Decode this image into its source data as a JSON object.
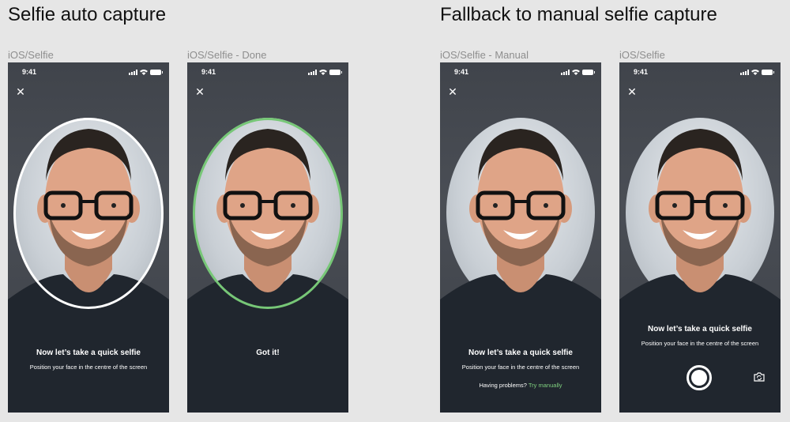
{
  "sections": [
    {
      "title": "Selfie auto capture"
    },
    {
      "title": "Fallback to manual selfie capture"
    }
  ],
  "screens": [
    {
      "label": "iOS/Selfie",
      "time": "9:41",
      "prompt": "Now let’s take a quick selfie",
      "subprompt": "Position your face in the centre of the screen"
    },
    {
      "label": "iOS/Selfie - Done",
      "time": "9:41",
      "prompt": "Got it!"
    },
    {
      "label": "iOS/Selfie - Manual",
      "time": "9:41",
      "prompt": "Now let’s take a quick selfie",
      "subprompt": "Position your face in the centre of the screen",
      "help_text": "Having problems?",
      "help_link": "Try manually"
    },
    {
      "label": "iOS/Selfie",
      "time": "9:41",
      "prompt": "Now let’s take a quick selfie",
      "subprompt": "Position your face in the centre of the screen"
    }
  ],
  "icons": {
    "close": "close-icon",
    "shutter": "shutter-button",
    "switch_camera": "switch-camera-icon"
  },
  "colors": {
    "success_ring": "#77c777",
    "guide_ring": "#ffffff",
    "link": "#7fd07f",
    "screen_bg": "#44484f"
  }
}
